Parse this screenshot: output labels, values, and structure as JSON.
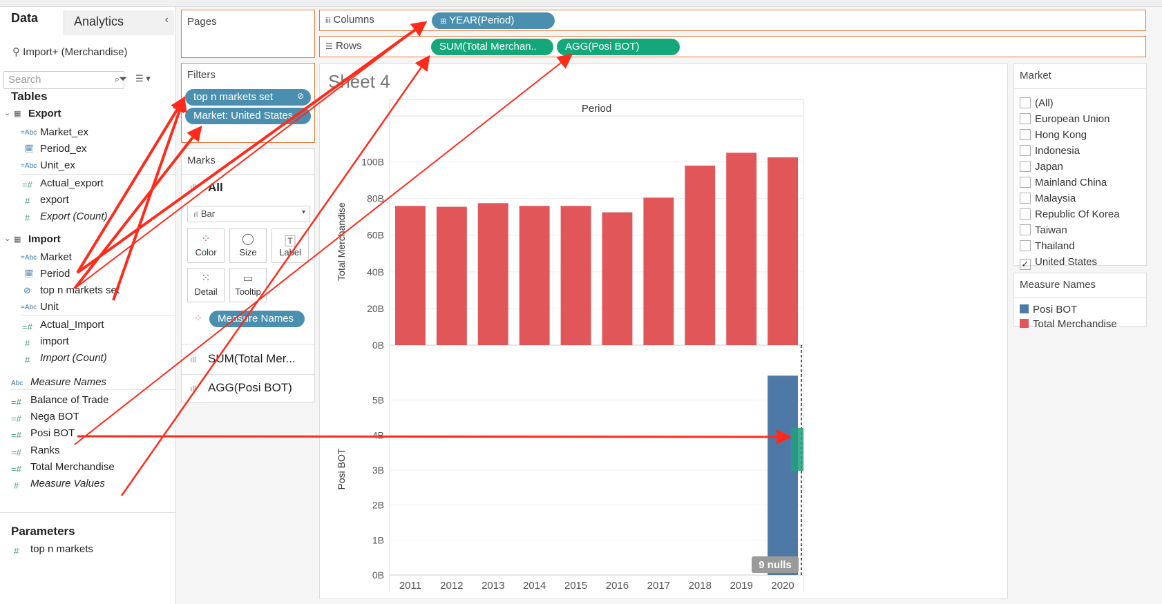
{
  "tabs": {
    "data": "Data",
    "analytics": "Analytics"
  },
  "datasource": "Import+ (Merchandise)",
  "search_placeholder": "Search",
  "tables_title": "Tables",
  "export_table": {
    "name": "Export",
    "fields": [
      "Market_ex",
      "Period_ex",
      "Unit_ex",
      "Actual_export",
      "export",
      "Export (Count)"
    ]
  },
  "import_table": {
    "name": "Import",
    "fields": [
      "Market",
      "Period",
      "top n markets set",
      "Unit",
      "Actual_Import",
      "import",
      "Import (Count)"
    ]
  },
  "extra_fields": [
    "Measure Names",
    "Balance of Trade",
    "Nega BOT",
    "Posi BOT",
    "Ranks",
    "Total Merchandise",
    "Measure Values"
  ],
  "parameters_title": "Parameters",
  "parameters": [
    "top n markets"
  ],
  "pages_title": "Pages",
  "filters_title": "Filters",
  "filters": [
    "top n markets set",
    "Market: United States"
  ],
  "marks": {
    "title": "Marks",
    "all_label": "All",
    "mark_type": "Bar",
    "buttons": {
      "color": "Color",
      "size": "Size",
      "label": "Label",
      "detail": "Detail",
      "tooltip": "Tooltip"
    },
    "color_pill": "Measure Names",
    "measure_cards": [
      "SUM(Total Mer...",
      "AGG(Posi BOT)"
    ]
  },
  "columns": {
    "label": "Columns",
    "pill": "YEAR(Period)"
  },
  "rows": {
    "label": "Rows",
    "pills": [
      "SUM(Total Merchan..",
      "AGG(Posi BOT)"
    ]
  },
  "sheet_title": "Sheet 4",
  "market_legend": {
    "title": "Market",
    "items": [
      {
        "label": "(All)",
        "checked": false
      },
      {
        "label": "European Union",
        "checked": false
      },
      {
        "label": "Hong Kong",
        "checked": false
      },
      {
        "label": "Indonesia",
        "checked": false
      },
      {
        "label": "Japan",
        "checked": false
      },
      {
        "label": "Mainland China",
        "checked": false
      },
      {
        "label": "Malaysia",
        "checked": false
      },
      {
        "label": "Republic Of Korea",
        "checked": false
      },
      {
        "label": "Taiwan",
        "checked": false
      },
      {
        "label": "Thailand",
        "checked": false
      },
      {
        "label": "United States",
        "checked": true
      }
    ]
  },
  "measure_legend": {
    "title": "Measure Names",
    "items": [
      {
        "label": "Posi BOT",
        "color": "#4e79a7"
      },
      {
        "label": "Total Merchandise",
        "color": "#e15759"
      }
    ]
  },
  "chart_data": {
    "type": "bar",
    "header": "Period",
    "categories": [
      "2011",
      "2012",
      "2013",
      "2014",
      "2015",
      "2016",
      "2017",
      "2018",
      "2019",
      "2020"
    ],
    "series": [
      {
        "name": "Total Merchandise",
        "color": "#e15759",
        "values": [
          76,
          75.5,
          77.5,
          76,
          76,
          72.5,
          80.5,
          98,
          105,
          102.5
        ],
        "ylabel": "Total Merchandise",
        "ticks": [
          "0B",
          "20B",
          "40B",
          "60B",
          "80B",
          "100B"
        ],
        "ylim": [
          0,
          110
        ]
      },
      {
        "name": "Posi BOT",
        "color": "#4e79a7",
        "values": [
          null,
          null,
          null,
          null,
          null,
          null,
          null,
          null,
          null,
          5.7
        ],
        "ylabel": "Posi BOT",
        "ticks": [
          "0B",
          "1B",
          "2B",
          "3B",
          "4B",
          "5B"
        ],
        "ylim": [
          0,
          5.9
        ]
      }
    ],
    "nulls_label": "9 nulls"
  },
  "annotation_color": "#ff2a1a"
}
